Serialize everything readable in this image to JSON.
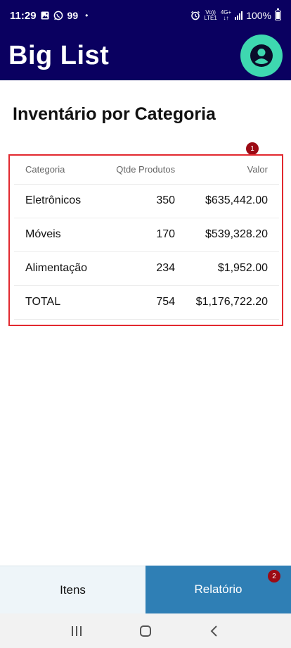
{
  "status_bar": {
    "time": "11:29",
    "dot": "•",
    "num99": "99",
    "volte_top": "Vo))",
    "volte_bottom": "LTE1",
    "net_top": "4G+",
    "net_bottom": "↓↑",
    "battery_pct": "100%",
    "icons": [
      "gallery-icon",
      "whatsapp-icon",
      "alarm-icon",
      "signal-icon",
      "battery-icon"
    ]
  },
  "app": {
    "title": "Big List",
    "profile_icon": "account-circle-icon",
    "header_color": "#0a0060",
    "accent": "#3ed8b0"
  },
  "page": {
    "title": "Inventário por Categoria"
  },
  "table": {
    "headers": [
      "Categoria",
      "Qtde Produtos",
      "Valor"
    ],
    "rows": [
      {
        "categoria": "Eletrônicos",
        "qtde": "350",
        "valor": "$635,442.00"
      },
      {
        "categoria": "Móveis",
        "qtde": "170",
        "valor": "$539,328.20"
      },
      {
        "categoria": "Alimentação",
        "qtde": "234",
        "valor": "$1,952.00"
      },
      {
        "categoria": "TOTAL",
        "qtde": "754",
        "valor": "$1,176,722.20"
      }
    ]
  },
  "annotations": {
    "badge_1": "1",
    "badge_2": "2",
    "highlight_color": "#e2292f"
  },
  "bottom_nav": {
    "tabs": [
      {
        "label": "Itens",
        "active": false
      },
      {
        "label": "Relatório",
        "active": true
      }
    ],
    "active_color": "#2f7fb5"
  },
  "system_nav": {
    "icons": [
      "recents-icon",
      "home-icon",
      "back-icon"
    ]
  }
}
